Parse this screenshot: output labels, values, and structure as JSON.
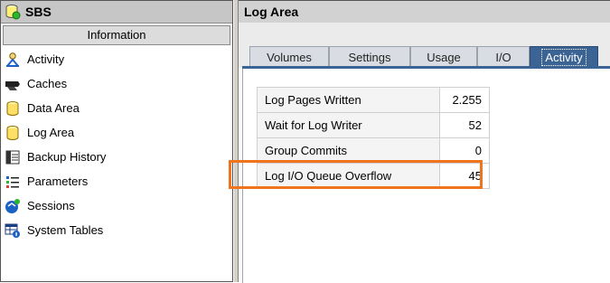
{
  "sidebar": {
    "title": "SBS",
    "section": "Information",
    "items": [
      {
        "label": "Activity",
        "icon": "activity-icon"
      },
      {
        "label": "Caches",
        "icon": "caches-icon"
      },
      {
        "label": "Data Area",
        "icon": "database-icon"
      },
      {
        "label": "Log Area",
        "icon": "database-icon"
      },
      {
        "label": "Backup History",
        "icon": "backup-icon"
      },
      {
        "label": "Parameters",
        "icon": "parameters-icon"
      },
      {
        "label": "Sessions",
        "icon": "sessions-icon"
      },
      {
        "label": "System Tables",
        "icon": "system-tables-icon"
      }
    ]
  },
  "main": {
    "title": "Log Area",
    "tabs": [
      {
        "label": "Volumes"
      },
      {
        "label": "Settings"
      },
      {
        "label": "Usage"
      },
      {
        "label": "I/O"
      },
      {
        "label": "Activity",
        "active": true
      }
    ],
    "table": {
      "rows": [
        {
          "name": "Log Pages Written",
          "value": "2.255"
        },
        {
          "name": "Wait for Log Writer",
          "value": "52"
        },
        {
          "name": "Group Commits",
          "value": "0"
        },
        {
          "name": "Log I/O Queue Overflow",
          "value": "45"
        }
      ]
    }
  },
  "colors": {
    "highlight": "#f0741e",
    "active_tab": "#3b6394"
  }
}
